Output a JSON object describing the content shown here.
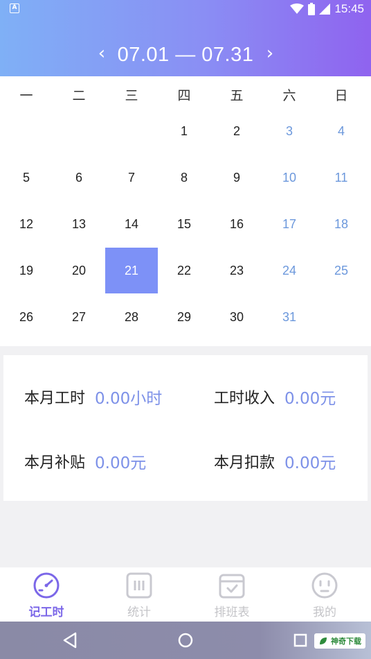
{
  "status_bar": {
    "time": "15:45",
    "app_icon_letter": "A"
  },
  "header": {
    "prev_arrow": "‹",
    "next_arrow": "›",
    "range": "07.01 — 07.31"
  },
  "calendar": {
    "weekdays": [
      "一",
      "二",
      "三",
      "四",
      "五",
      "六",
      "日"
    ],
    "first_weekday_index": 3,
    "days_in_month": 31,
    "selected_day": 21,
    "weekend_color": "#6c98dc",
    "selected_color": "#7d91f7"
  },
  "summary": {
    "hours": {
      "label": "本月工时",
      "value": "0.00小时"
    },
    "income": {
      "label": "工时收入",
      "value": "0.00元"
    },
    "allowance": {
      "label": "本月补贴",
      "value": "0.00元"
    },
    "deduction": {
      "label": "本月扣款",
      "value": "0.00元"
    }
  },
  "bottom_nav": [
    {
      "label": "记工时",
      "icon": "gauge-icon",
      "active": true
    },
    {
      "label": "统计",
      "icon": "stats-icon",
      "active": false
    },
    {
      "label": "排班表",
      "icon": "calendar-check-icon",
      "active": false
    },
    {
      "label": "我的",
      "icon": "smiley-icon",
      "active": false
    }
  ],
  "watermark": {
    "text": "神奇下载"
  },
  "colors": {
    "accent": "#7b67e8",
    "value_blue": "#7d91e8",
    "gradient_start": "#7fb0f6",
    "gradient_end": "#8f63ef"
  }
}
